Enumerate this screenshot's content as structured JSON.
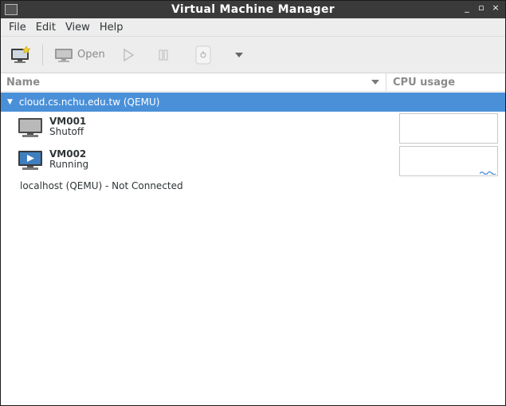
{
  "window": {
    "title": "Virtual Machine Manager"
  },
  "wm_controls": {
    "minimize": "_",
    "maximize": "▫",
    "close": "×"
  },
  "menubar": {
    "items": [
      "File",
      "Edit",
      "View",
      "Help"
    ]
  },
  "toolbar": {
    "new_vm_icon": "new-vm-icon",
    "open_label": "Open",
    "run_icon": "play-icon",
    "pause_icon": "pause-icon",
    "shutdown_icon": "power-icon",
    "more_icon": "dropdown-arrow-icon"
  },
  "columns": {
    "name": "Name",
    "cpu": "CPU usage"
  },
  "connections": [
    {
      "label": "cloud.cs.nchu.edu.tw (QEMU)",
      "expanded": true,
      "vms": [
        {
          "name": "VM001",
          "state": "Shutoff",
          "icon": "monitor-off-icon"
        },
        {
          "name": "VM002",
          "state": "Running",
          "icon": "monitor-running-icon"
        }
      ]
    },
    {
      "label": "localhost (QEMU) - Not Connected",
      "expanded": false,
      "vms": []
    }
  ],
  "colors": {
    "selection": "#4a90d9",
    "titlebar": "#3a3a3a",
    "toolbar_bg": "#ededed"
  }
}
